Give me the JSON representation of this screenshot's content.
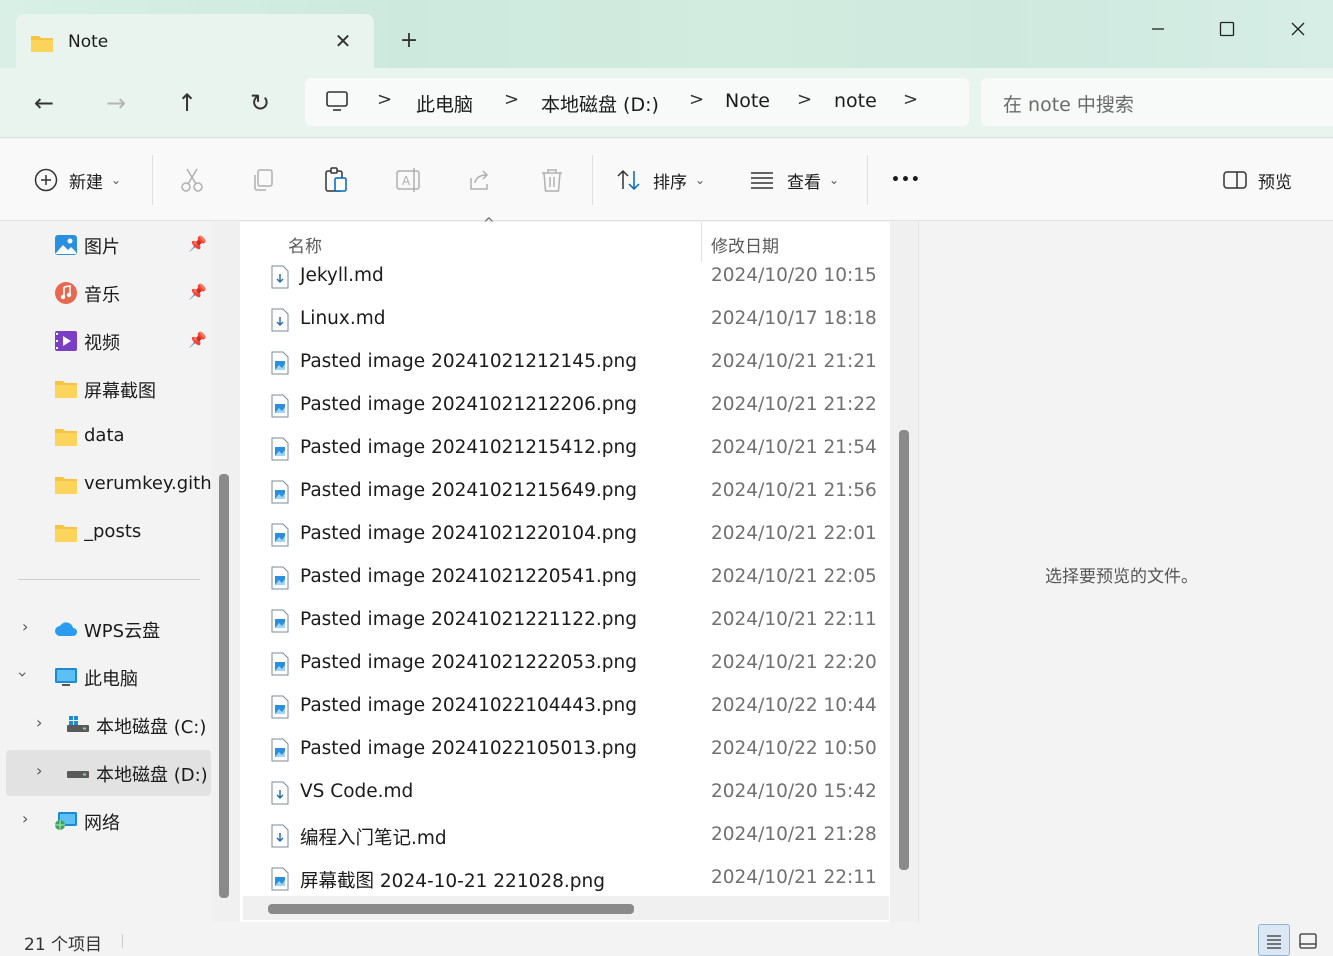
{
  "window": {
    "tab_title": "Note",
    "new_tab": "+",
    "close_tab": "✕",
    "minimize": "—",
    "maximize": "☐",
    "close": "✕"
  },
  "nav": {
    "back": "←",
    "forward": "→",
    "up": "↑",
    "refresh": "↻",
    "breadcrumb": [
      "此电脑",
      "本地磁盘 (D:)",
      "Note",
      "note"
    ],
    "separator": ">",
    "search_placeholder": "在 note 中搜索"
  },
  "toolbar": {
    "new_label": "新建",
    "sort_label": "排序",
    "view_label": "查看",
    "more_label": "•••",
    "preview_label": "预览"
  },
  "sidebar": {
    "pinned": [
      {
        "label": "图片",
        "icon": "pictures-icon"
      },
      {
        "label": "音乐",
        "icon": "music-icon"
      },
      {
        "label": "视频",
        "icon": "videos-icon"
      }
    ],
    "folders": [
      "屏幕截图",
      "data",
      "verumkey.githu",
      "_posts"
    ],
    "tree": [
      {
        "label": "WPS云盘",
        "icon": "cloud-icon",
        "expanded": false
      },
      {
        "label": "此电脑",
        "icon": "computer-icon",
        "expanded": true
      },
      {
        "label": "本地磁盘 (C:)",
        "icon": "drive-icon",
        "expanded": false
      },
      {
        "label": "本地磁盘 (D:)",
        "icon": "drive-icon",
        "expanded": false,
        "selected": true
      },
      {
        "label": "网络",
        "icon": "network-icon",
        "expanded": false
      }
    ]
  },
  "filelist": {
    "col_name": "名称",
    "col_date": "修改日期",
    "files": [
      {
        "name": "Jekyll.md",
        "date": "2024/10/20 10:15",
        "type": "md"
      },
      {
        "name": "Linux.md",
        "date": "2024/10/17 18:18",
        "type": "md"
      },
      {
        "name": "Pasted image 20241021212145.png",
        "date": "2024/10/21 21:21",
        "type": "png"
      },
      {
        "name": "Pasted image 20241021212206.png",
        "date": "2024/10/21 21:22",
        "type": "png"
      },
      {
        "name": "Pasted image 20241021215412.png",
        "date": "2024/10/21 21:54",
        "type": "png"
      },
      {
        "name": "Pasted image 20241021215649.png",
        "date": "2024/10/21 21:56",
        "type": "png"
      },
      {
        "name": "Pasted image 20241021220104.png",
        "date": "2024/10/21 22:01",
        "type": "png"
      },
      {
        "name": "Pasted image 20241021220541.png",
        "date": "2024/10/21 22:05",
        "type": "png"
      },
      {
        "name": "Pasted image 20241021221122.png",
        "date": "2024/10/21 22:11",
        "type": "png"
      },
      {
        "name": "Pasted image 20241021222053.png",
        "date": "2024/10/21 22:20",
        "type": "png"
      },
      {
        "name": "Pasted image 20241022104443.png",
        "date": "2024/10/22 10:44",
        "type": "png"
      },
      {
        "name": "Pasted image 20241022105013.png",
        "date": "2024/10/22 10:50",
        "type": "png"
      },
      {
        "name": "VS Code.md",
        "date": "2024/10/20 15:42",
        "type": "md"
      },
      {
        "name": "编程入门笔记.md",
        "date": "2024/10/21 21:28",
        "type": "md"
      },
      {
        "name": "屏幕截图 2024-10-21 221028.png",
        "date": "2024/10/21 22:11",
        "type": "png"
      }
    ]
  },
  "preview": {
    "empty_text": "选择要预览的文件。"
  },
  "status": {
    "item_count": "21 个项目"
  },
  "colors": {
    "folder": "#f6c343",
    "accent": "#0067c0",
    "scrollbar": "#8a8a8a"
  }
}
